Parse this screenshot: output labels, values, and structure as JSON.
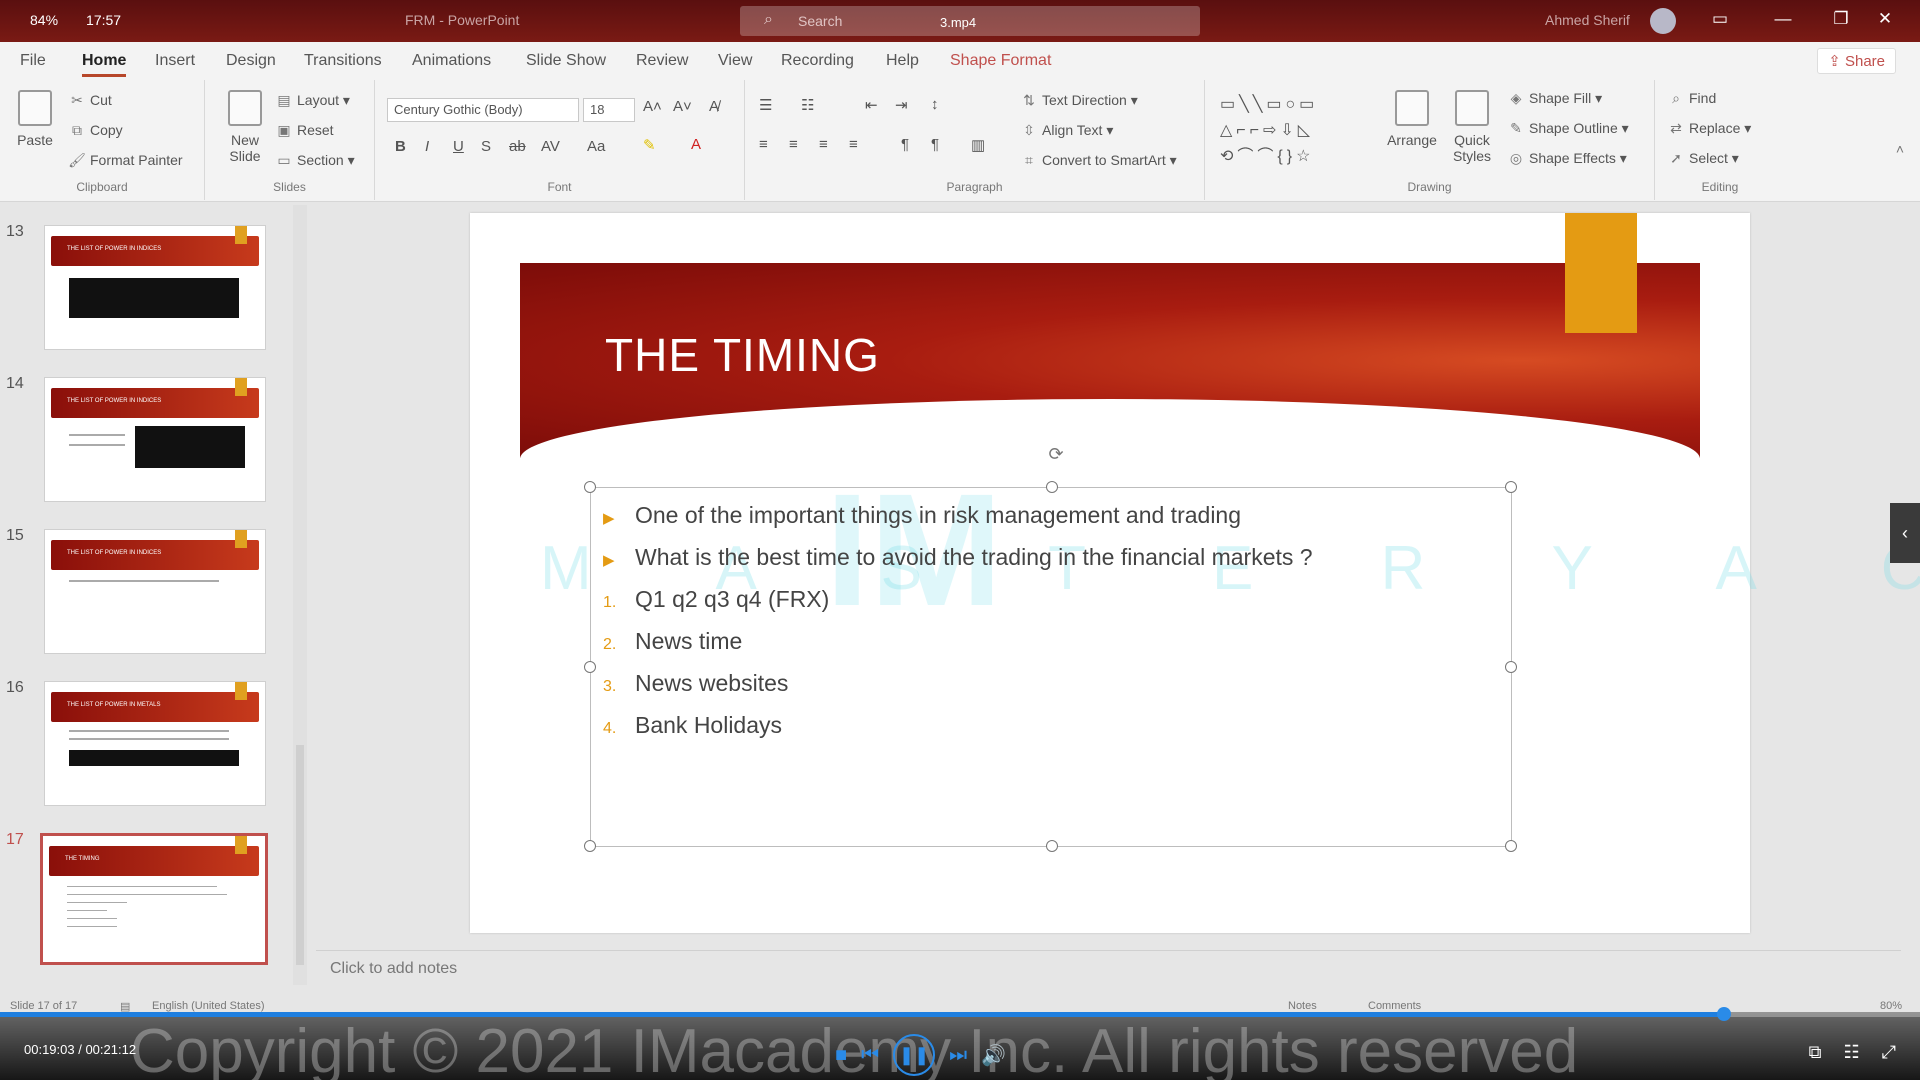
{
  "titlebar": {
    "battery": "84%",
    "clock": "17:57",
    "app_title": "FRM  -  PowerPoint",
    "search_placeholder": "Search",
    "video_file": "3.mp4",
    "user_name": "Ahmed Sherif"
  },
  "tabs": [
    "File",
    "Home",
    "Insert",
    "Design",
    "Transitions",
    "Animations",
    "Slide Show",
    "Review",
    "View",
    "Recording",
    "Help",
    "Shape Format"
  ],
  "active_tab": "Home",
  "share_label": "Share",
  "ribbon": {
    "clipboard": {
      "paste": "Paste",
      "cut": "Cut",
      "copy": "Copy",
      "format_painter": "Format Painter",
      "group": "Clipboard"
    },
    "slides": {
      "new_slide": "New Slide",
      "layout": "Layout",
      "reset": "Reset",
      "section": "Section",
      "group": "Slides"
    },
    "font": {
      "name": "Century Gothic (Body)",
      "size": "18",
      "group": "Font"
    },
    "paragraph": {
      "text_direction": "Text Direction",
      "align_text": "Align Text",
      "convert_smartart": "Convert to SmartArt",
      "group": "Paragraph"
    },
    "drawing": {
      "arrange": "Arrange",
      "quick_styles": "Quick Styles",
      "shape_fill": "Shape Fill",
      "shape_outline": "Shape Outline",
      "shape_effects": "Shape Effects",
      "group": "Drawing"
    },
    "editing": {
      "find": "Find",
      "replace": "Replace",
      "select": "Select",
      "group": "Editing"
    }
  },
  "thumbnails": [
    {
      "number": "13",
      "title": "THE LIST OF POWER IN INDICES"
    },
    {
      "number": "14",
      "title": "THE LIST OF POWER IN INDICES"
    },
    {
      "number": "15",
      "title": "THE LIST OF POWER IN INDICES"
    },
    {
      "number": "16",
      "title": "THE LIST OF POWER IN METALS"
    },
    {
      "number": "17",
      "title": "THE TIMING"
    }
  ],
  "slide": {
    "title": "THE TIMING",
    "bullets": [
      {
        "marker": "▶",
        "text": "One of the important things in risk management and trading"
      },
      {
        "marker": "▶",
        "text": "What is the best time to avoid the trading in the financial markets ?"
      },
      {
        "marker": "1.",
        "text": "Q1   q2   q3   q4    (FRX)"
      },
      {
        "marker": "2.",
        "text": "News time"
      },
      {
        "marker": "3.",
        "text": "News websites"
      },
      {
        "marker": "4.",
        "text": "Bank Holidays"
      }
    ],
    "watermark": "M A S T E R Y   A C A D E M Y",
    "watermark_logo": "IM"
  },
  "notes_placeholder": "Click to add notes",
  "status": {
    "slide_count": "Slide 17 of 17",
    "language": "English (United States)",
    "notes": "Notes",
    "comments": "Comments",
    "zoom": "80%"
  },
  "player": {
    "time": "00:19:03 / 00:21:12",
    "progress": 0.898,
    "copyright": "Copyright © 2021 IMacademy Inc. All rights reserved"
  }
}
